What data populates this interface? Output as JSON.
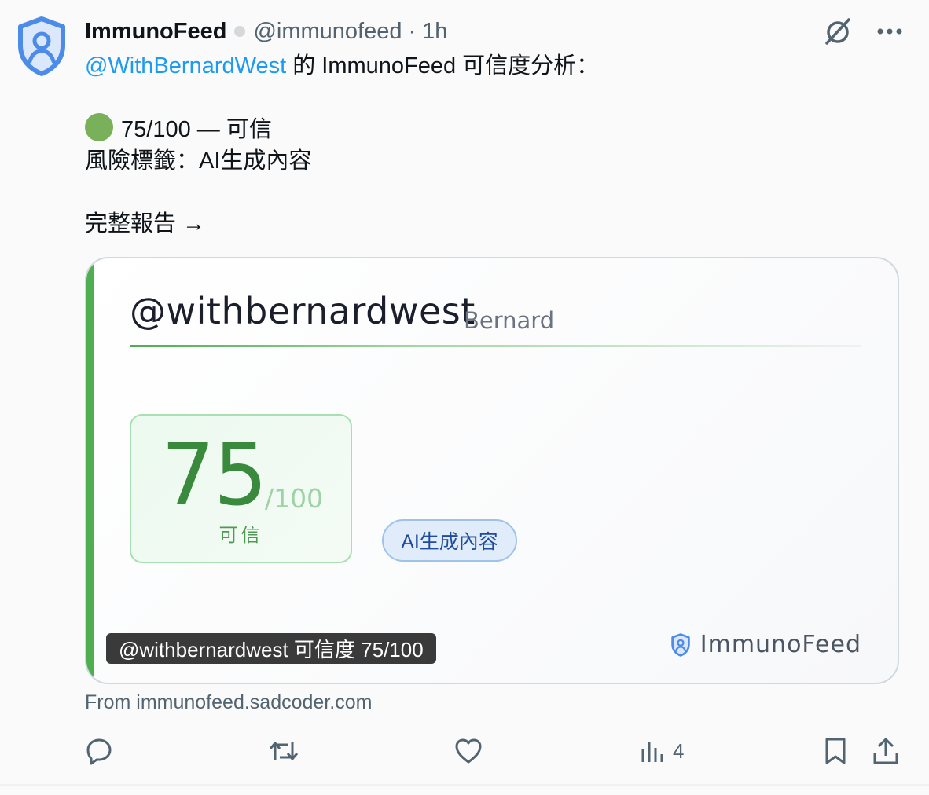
{
  "post": {
    "display_name": "ImmunoFeed",
    "handle": "@immunofeed",
    "separator": "·",
    "time": "1h",
    "mention": "@WithBernardWest",
    "intro_suffix": " 的 ImmunoFeed 可信度分析：",
    "score_line": "75/100 — 可信",
    "risk_line": "風險標籤：AI生成內容",
    "report_link": "完整報告 →",
    "source": "From immunofeed.sadcoder.com"
  },
  "card": {
    "handle": "@withbernardwest",
    "display_name": "Bernard",
    "score": "75",
    "score_max": "/100",
    "score_label": "可信",
    "tag": "AI生成內容",
    "caption": "@withbernardwest 可信度 75/100",
    "brand": "ImmunoFeed"
  },
  "actions": {
    "views_count": "4"
  },
  "icons": {
    "avatar": "shield-person-icon",
    "grok": "grok-icon",
    "more": "more-icon",
    "reply": "reply-icon",
    "repost": "repost-icon",
    "like": "like-icon",
    "views": "views-icon",
    "bookmark": "bookmark-icon",
    "share": "share-icon"
  },
  "colors": {
    "brand_blue": "#4d8be8",
    "mention": "#1d9bf0",
    "score_green": "#3a8a3e",
    "accent_green": "#4fae4f",
    "tag_blue": "#1e4b9a"
  }
}
